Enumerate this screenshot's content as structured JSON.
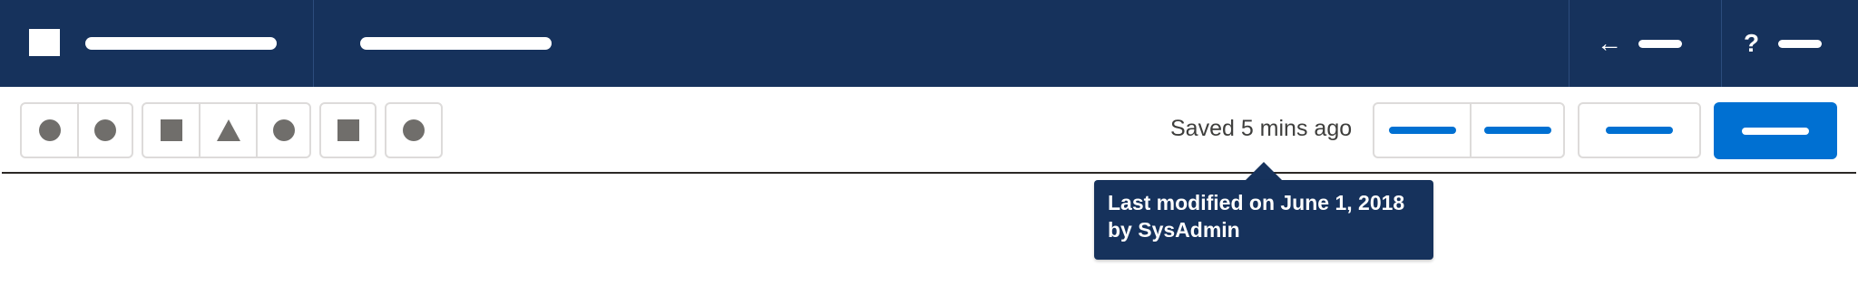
{
  "toolbar": {
    "saved_status": "Saved 5 mins ago"
  },
  "header": {
    "utility_items": [
      {
        "icon": "back-arrow-icon",
        "glyph": "←"
      },
      {
        "icon": "help-icon",
        "glyph": "?"
      }
    ]
  },
  "tooltip": {
    "line1": "Last modified on June 1, 2018",
    "line2": "by SysAdmin"
  },
  "colors": {
    "header_bg": "#16325c",
    "brand_blue": "#0070d2",
    "icon_gray": "#706e6b",
    "border_gray": "#dddbda"
  }
}
